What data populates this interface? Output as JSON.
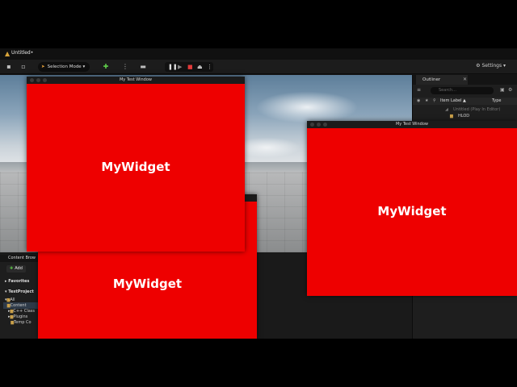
{
  "app": {
    "tab_title": "Untitled•",
    "toolbar": {
      "selection_mode": "Selection Mode",
      "settings": "Settings"
    }
  },
  "outliner": {
    "title": "Outliner",
    "search_placeholder": "Search...",
    "col_label": "Item Label ▲",
    "col_type": "Type",
    "rows": [
      {
        "label": "Untitled (Play In Editor)"
      },
      {
        "label": "HLOD"
      }
    ]
  },
  "content_browser": {
    "title": "Content Brow",
    "add_label": "Add",
    "favorites": "Favorites",
    "project": "TestProject",
    "tree": [
      "All",
      "Content",
      "C++ Class",
      "Plugins",
      "Temp Co"
    ]
  },
  "windows": [
    {
      "title": "My Test Window",
      "widget": "MyWidget"
    },
    {
      "title": "My Test Window",
      "widget": "MyWidget"
    },
    {
      "title": "",
      "widget": "MyWidget"
    }
  ],
  "colors": {
    "widget_red": "#ee0000",
    "accent_orange": "#e9a23a"
  }
}
